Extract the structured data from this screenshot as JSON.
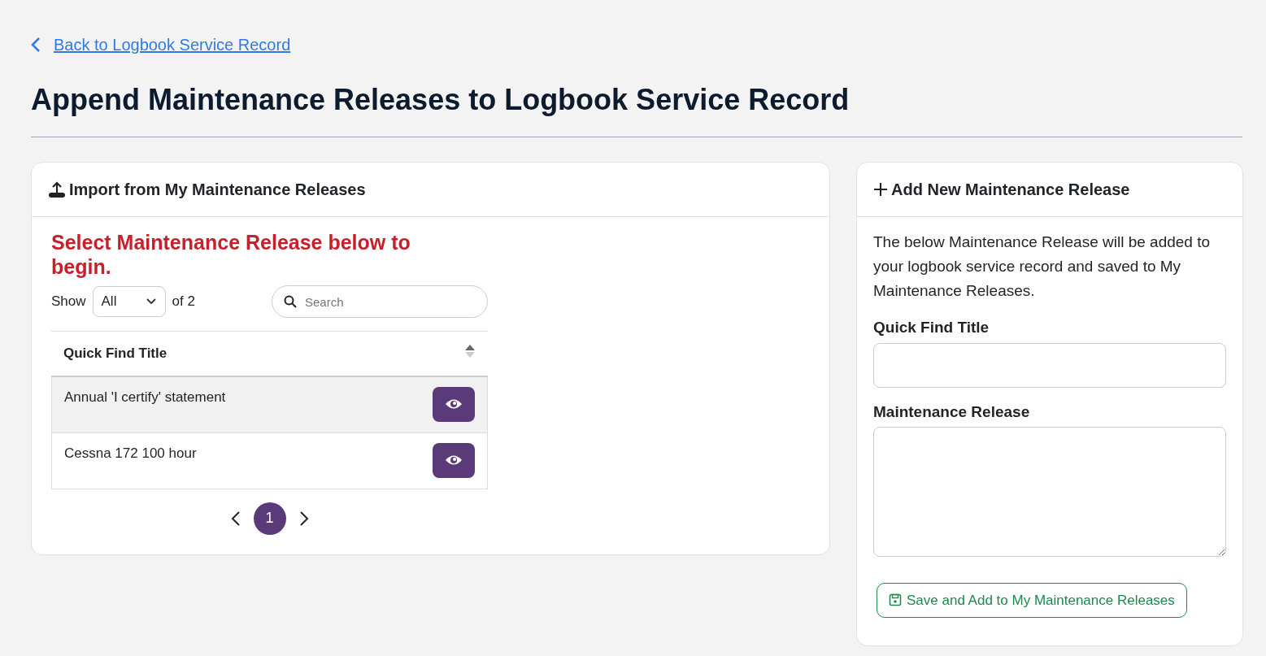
{
  "back_link": {
    "label": "Back to Logbook Service Record"
  },
  "page_title": "Append Maintenance Releases to Logbook Service Record",
  "import_panel": {
    "title": "Import from My Maintenance Releases",
    "prompt": "Select Maintenance Release below to begin.",
    "show_label": "Show",
    "page_size": "All",
    "count_label": "of 2",
    "search": {
      "placeholder": "Search"
    },
    "table": {
      "columns": [
        "Quick Find Title"
      ],
      "rows": [
        {
          "title": "Annual 'I certify' statement",
          "selected": true
        },
        {
          "title": "Cessna 172 100 hour",
          "selected": false
        }
      ]
    },
    "pagination": {
      "pages": [
        {
          "label": "1",
          "selected": true
        }
      ]
    }
  },
  "add_panel": {
    "title": "Add New Maintenance Release",
    "description": "The below Maintenance Release will be added to your logbook service record and saved to My Maintenance Releases.",
    "fields": [
      {
        "kind": "input",
        "label": "Quick Find Title"
      },
      {
        "kind": "textarea",
        "label": "Maintenance Release"
      }
    ],
    "save_button": "Save and Add to My Maintenance Releases"
  }
}
